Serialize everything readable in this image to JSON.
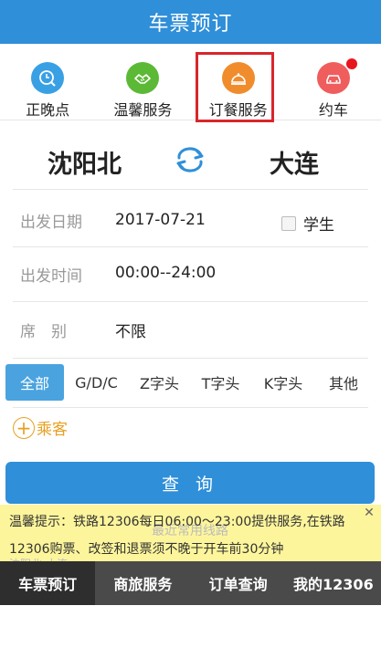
{
  "header": {
    "title": "车票预订"
  },
  "services": [
    {
      "label": "正晚点",
      "icon": "clock-search-icon",
      "color": "#3aa0e4"
    },
    {
      "label": "温馨服务",
      "icon": "handshake-icon",
      "color": "#5cb936"
    },
    {
      "label": "订餐服务",
      "icon": "meal-bell-icon",
      "color": "#f08c2c"
    },
    {
      "label": "约车",
      "icon": "car-icon",
      "color": "#ef5d5d"
    }
  ],
  "route": {
    "from": "沈阳北",
    "to": "大连",
    "swap_icon": "swap-arrows-icon",
    "accent": "#2f8fd9"
  },
  "form": {
    "date_label": "出发日期",
    "date_value": "2017-07-21",
    "student_label": "学生",
    "time_label": "出发时间",
    "time_value": "00:00--24:00",
    "seat_label": "席　别",
    "seat_value": "不限"
  },
  "train_types": [
    "全部",
    "G/D/C",
    "Z字头",
    "T字头",
    "K字头",
    "其他"
  ],
  "passenger": {
    "label": "乘客"
  },
  "query_button": "查 询",
  "notice": {
    "line1": "温馨提示：铁路12306每日06:00～23:00提供服务,在铁路",
    "line2": "12306购票、改签和退票须不晚于开车前30分钟",
    "ghost": "最近常用线路",
    "ghost2": "沈阳北-大连"
  },
  "tabbar": [
    "车票预订",
    "商旅服务",
    "订单查询",
    "我的12306"
  ]
}
